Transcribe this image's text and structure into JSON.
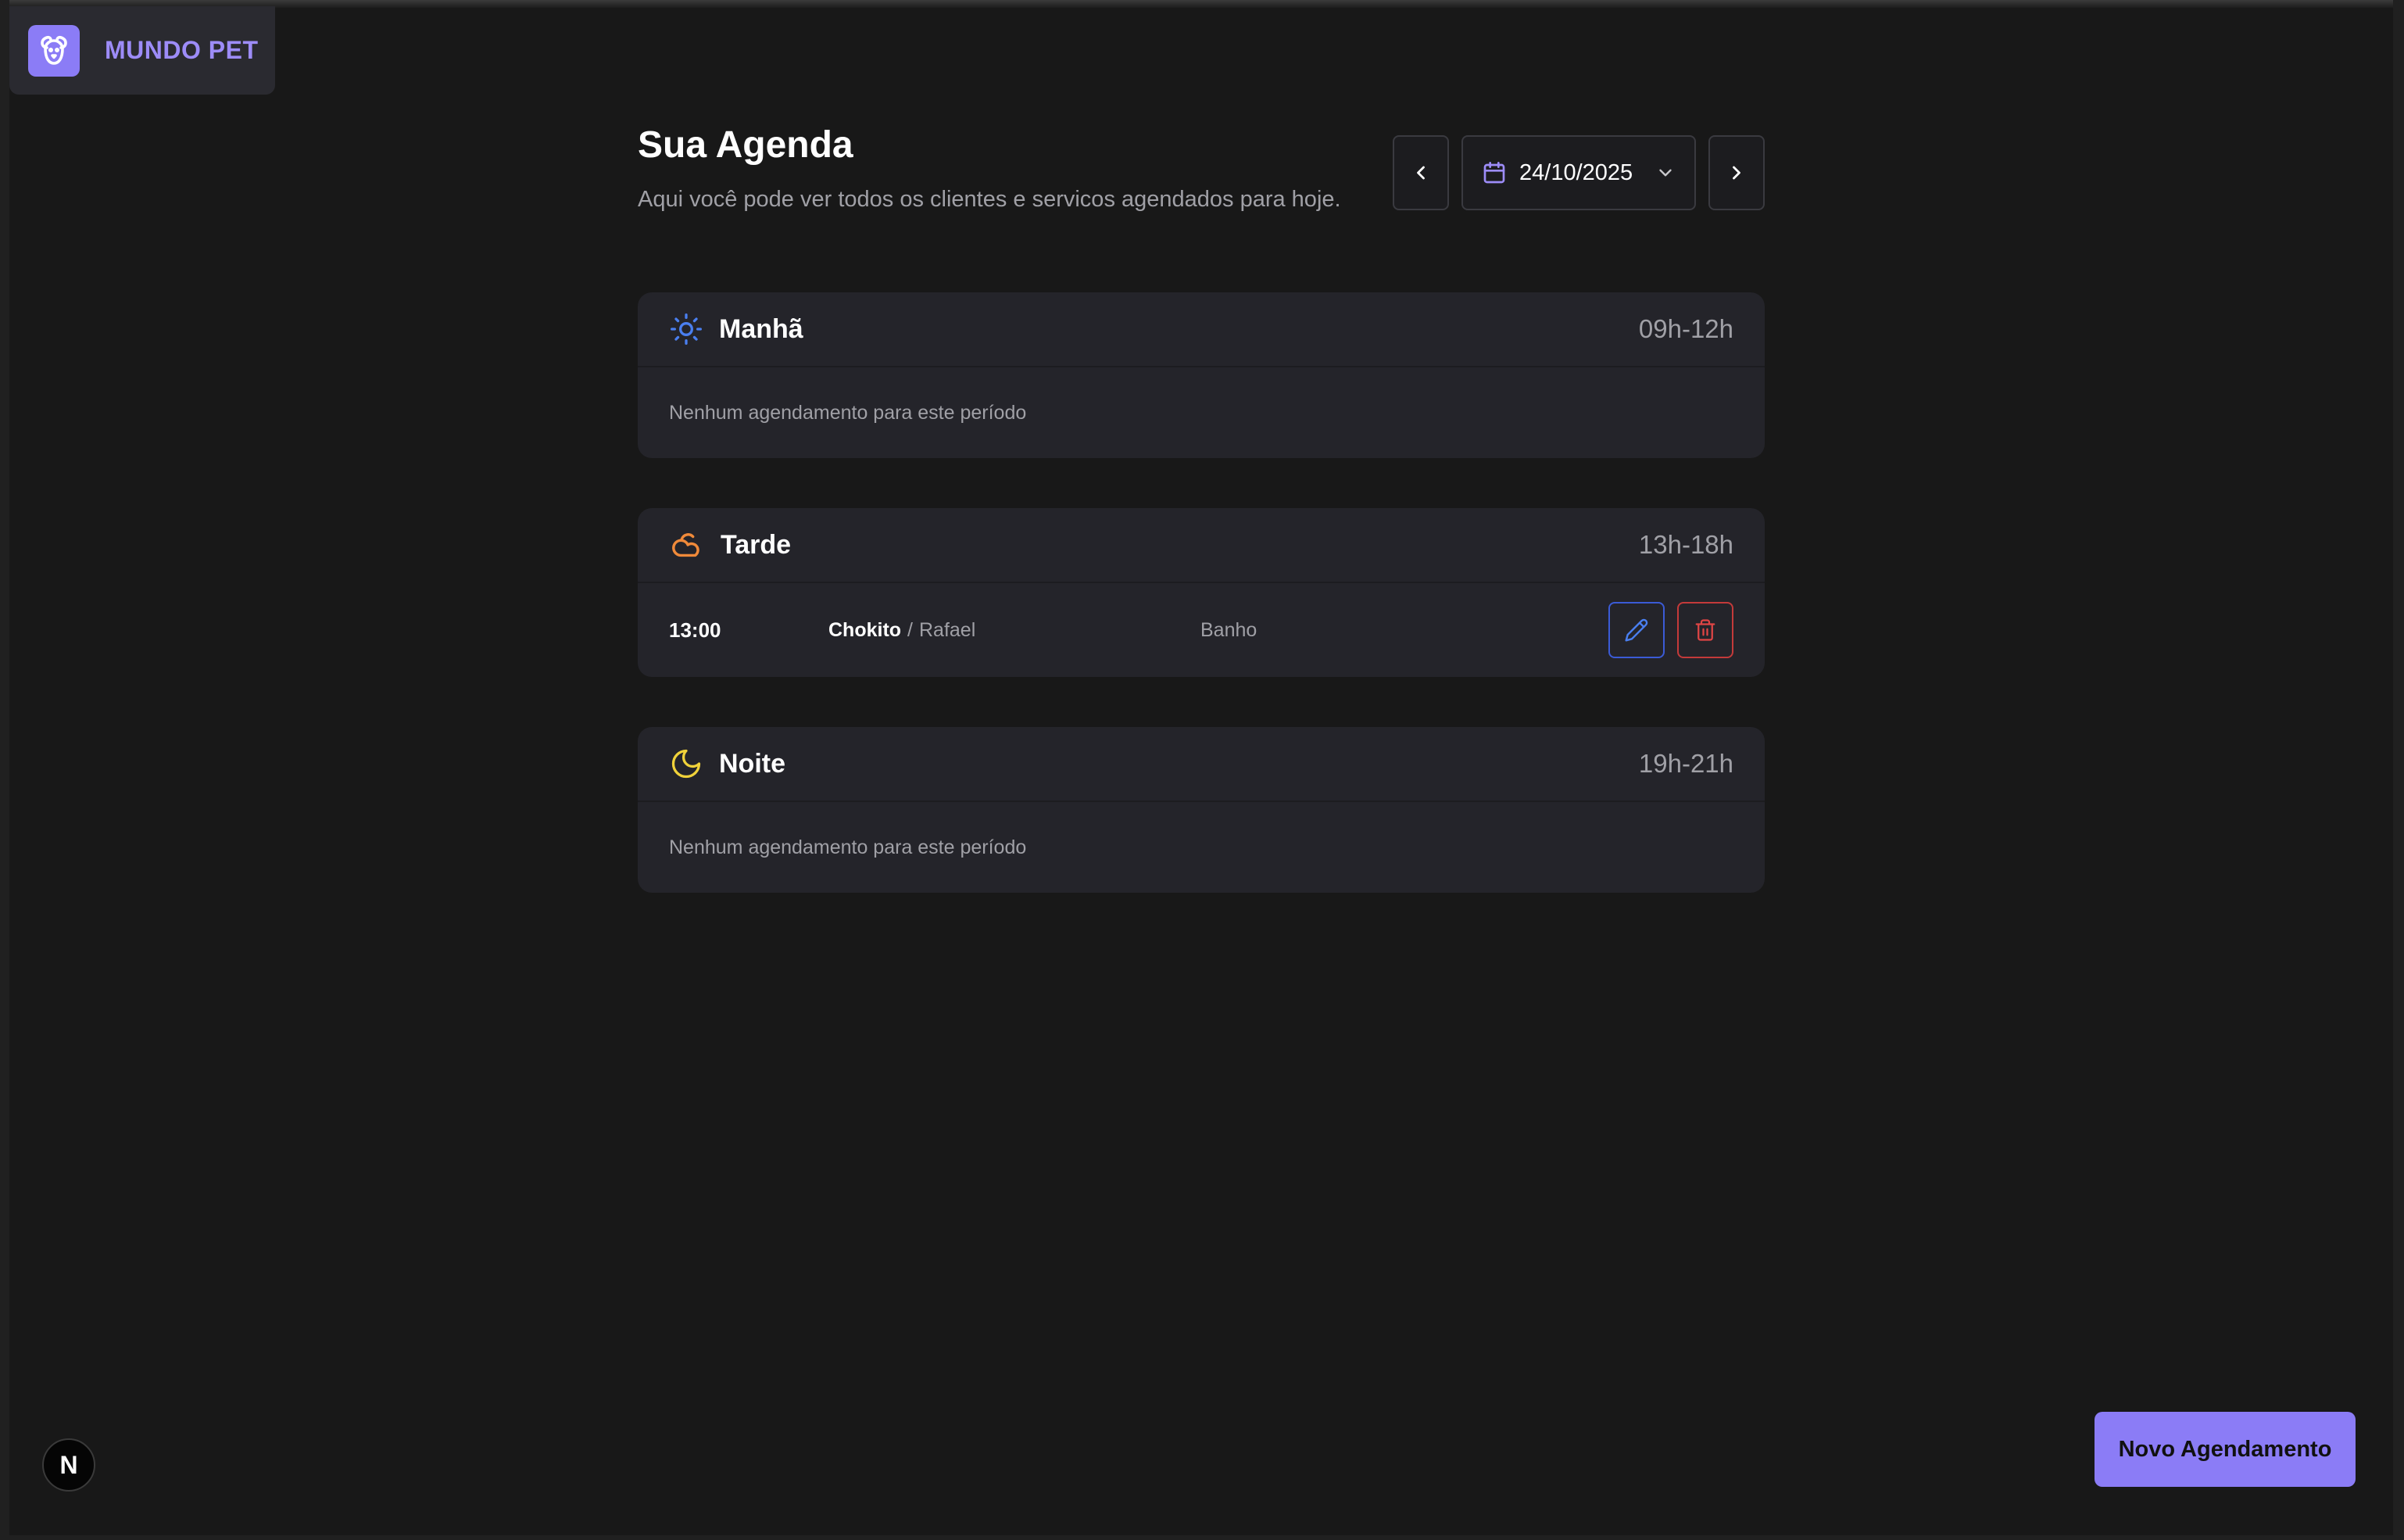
{
  "brand": {
    "name": "MUNDO PET",
    "logo_icon": "dog-face-icon",
    "accent": "#8b7cf6"
  },
  "header": {
    "title": "Sua Agenda",
    "subtitle": "Aqui você pode ver todos os clientes e servicos agendados para hoje.",
    "date": "24/10/2025"
  },
  "periods": [
    {
      "name": "Manhã",
      "range": "09h-12h",
      "icon": "sun-icon",
      "icon_color": "#4a7ff0",
      "empty": "Nenhum agendamento para este período"
    },
    {
      "name": "Tarde",
      "range": "13h-18h",
      "icon": "cloud-sun-icon",
      "icon_color": "#f08a3a",
      "appointments": [
        {
          "time": "13:00",
          "pet": "Chokito",
          "sep": "/",
          "owner": "Rafael",
          "service": "Banho"
        }
      ]
    },
    {
      "name": "Noite",
      "range": "19h-21h",
      "icon": "moon-icon",
      "icon_color": "#f0d23a",
      "empty": "Nenhum agendamento para este período"
    }
  ],
  "actions": {
    "new_label": "Novo Agendamento"
  },
  "dev_badge": {
    "label": "N"
  }
}
